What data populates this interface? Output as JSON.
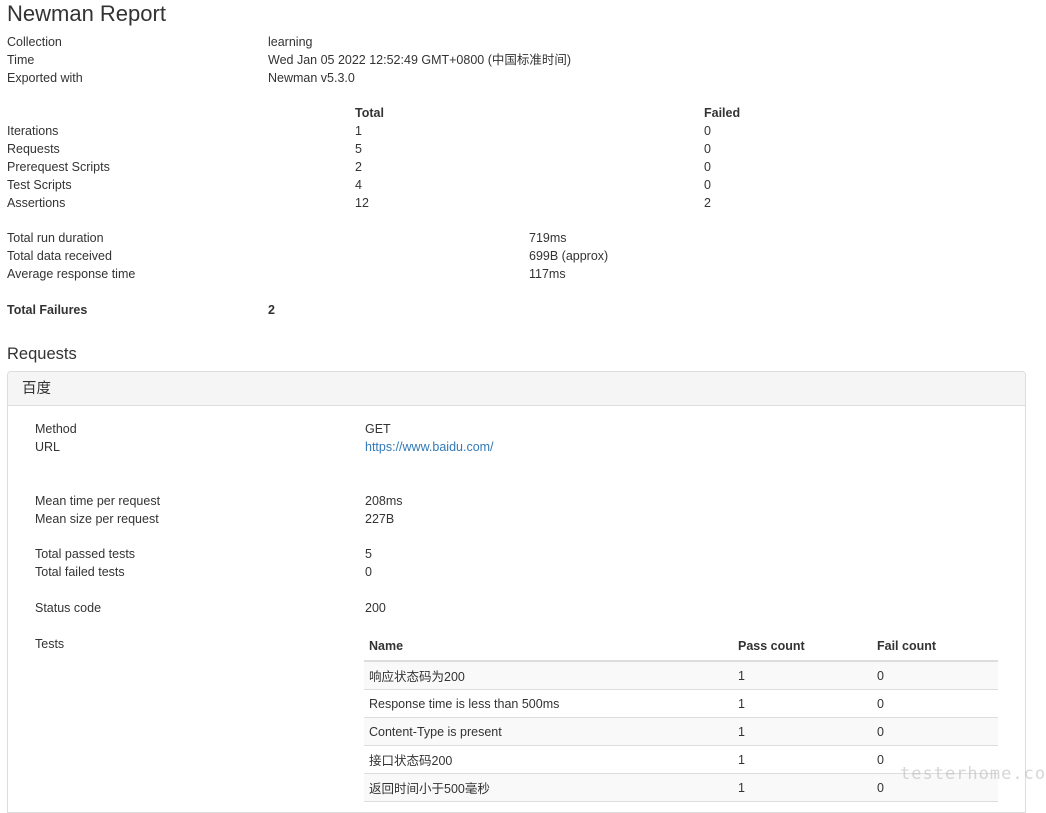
{
  "report": {
    "title": "Newman Report",
    "meta": [
      {
        "label": "Collection",
        "value": "learning"
      },
      {
        "label": "Time",
        "value": "Wed Jan 05 2022 12:52:49 GMT+0800 (中国标准时间)"
      },
      {
        "label": "Exported with",
        "value": "Newman v5.3.0"
      }
    ],
    "summary": {
      "header_total": "Total",
      "header_failed": "Failed",
      "rows": [
        {
          "label": "Iterations",
          "total": "1",
          "failed": "0"
        },
        {
          "label": "Requests",
          "total": "5",
          "failed": "0"
        },
        {
          "label": "Prerequest Scripts",
          "total": "2",
          "failed": "0"
        },
        {
          "label": "Test Scripts",
          "total": "4",
          "failed": "0"
        },
        {
          "label": "Assertions",
          "total": "12",
          "failed": "2"
        }
      ]
    },
    "timings": [
      {
        "label": "Total run duration",
        "value": "719ms"
      },
      {
        "label": "Total data received",
        "value": "699B (approx)"
      },
      {
        "label": "Average response time",
        "value": "117ms"
      }
    ],
    "total_failures": {
      "label": "Total Failures",
      "value": "2"
    }
  },
  "requests": {
    "section_title": "Requests",
    "items": [
      {
        "name": "百度",
        "method_label": "Method",
        "method": "GET",
        "url_label": "URL",
        "url": "https://www.baidu.com/",
        "mean_time_label": "Mean time per request",
        "mean_time": "208ms",
        "mean_size_label": "Mean size per request",
        "mean_size": "227B",
        "passed_label": "Total passed tests",
        "passed": "5",
        "failed_label": "Total failed tests",
        "failed": "0",
        "status_label": "Status code",
        "status": "200",
        "tests_label": "Tests",
        "tests_headers": {
          "name": "Name",
          "pass": "Pass count",
          "fail": "Fail count"
        },
        "tests": [
          {
            "name": "响应状态码为200",
            "pass": "1",
            "fail": "0"
          },
          {
            "name": "Response time is less than 500ms",
            "pass": "1",
            "fail": "0"
          },
          {
            "name": "Content-Type is present",
            "pass": "1",
            "fail": "0"
          },
          {
            "name": "接口状态码200",
            "pass": "1",
            "fail": "0"
          },
          {
            "name": "返回时间小于500毫秒",
            "pass": "1",
            "fail": "0"
          }
        ]
      }
    ]
  },
  "watermark": "testerhome.com"
}
